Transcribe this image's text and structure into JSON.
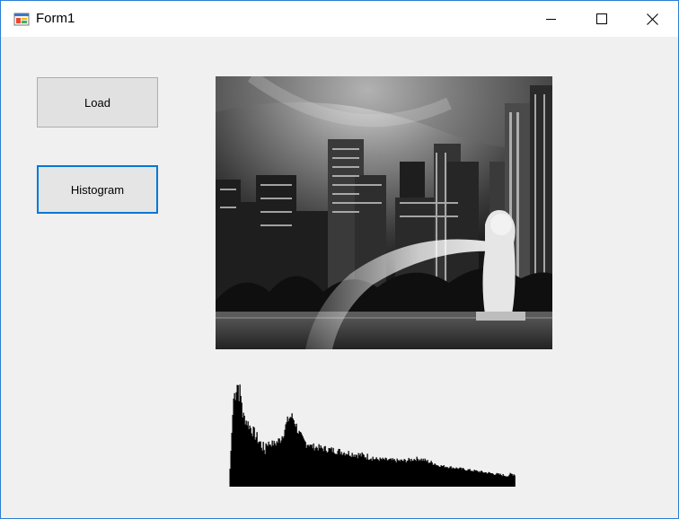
{
  "window": {
    "title": "Form1",
    "icon": "winforms-app-icon",
    "controls": {
      "minimize_icon": "minimize-icon",
      "maximize_icon": "maximize-icon",
      "close_icon": "close-icon"
    }
  },
  "buttons": {
    "load_label": "Load",
    "histogram_label": "Histogram"
  },
  "picture": {
    "description_icon": "grayscale-city-skyline-merlion-photo"
  },
  "histogram": {
    "bar_color": "#000000"
  },
  "colors": {
    "accent": "#0078d7",
    "window_border": "#2a7fd4",
    "client_bg": "#f0f0f0"
  }
}
